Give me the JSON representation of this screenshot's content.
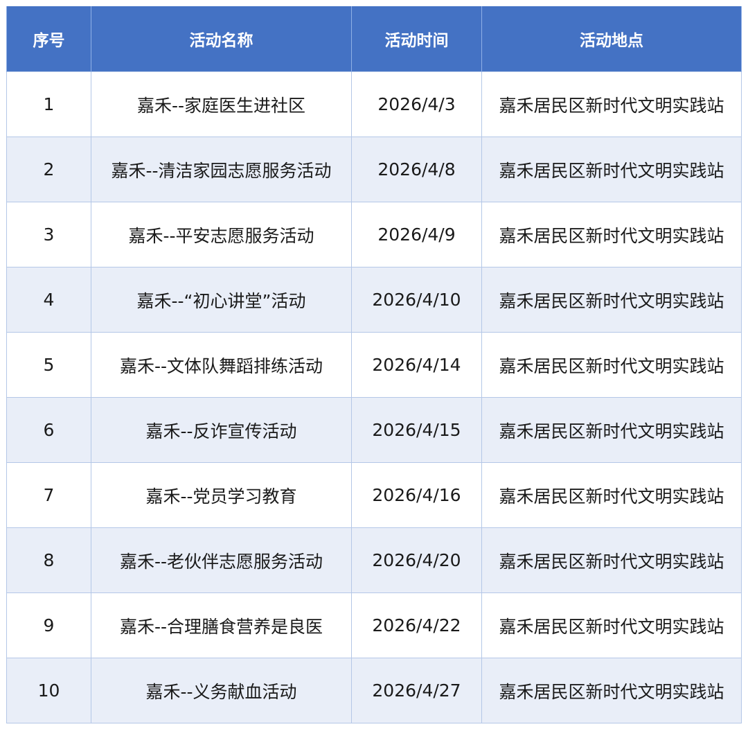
{
  "table": {
    "headers": [
      "序号",
      "活动名称",
      "活动时间",
      "活动地点"
    ],
    "rows": [
      [
        "1",
        "嘉禾--家庭医生进社区",
        "2026/4/3",
        "嘉禾居民区新时代文明实践站"
      ],
      [
        "2",
        "嘉禾--清洁家园志愿服务活动",
        "2026/4/8",
        "嘉禾居民区新时代文明实践站"
      ],
      [
        "3",
        "嘉禾--平安志愿服务活动",
        "2026/4/9",
        "嘉禾居民区新时代文明实践站"
      ],
      [
        "4",
        "嘉禾--“初心讲堂”活动",
        "2026/4/10",
        "嘉禾居民区新时代文明实践站"
      ],
      [
        "5",
        "嘉禾--文体队舞蹈排练活动",
        "2026/4/14",
        "嘉禾居民区新时代文明实践站"
      ],
      [
        "6",
        "嘉禾--反诈宣传活动",
        "2026/4/15",
        "嘉禾居民区新时代文明实践站"
      ],
      [
        "7",
        "嘉禾--党员学习教育",
        "2026/4/16",
        "嘉禾居民区新时代文明实践站"
      ],
      [
        "8",
        "嘉禾--老伙伴志愿服务活动",
        "2026/4/20",
        "嘉禾居民区新时代文明实践站"
      ],
      [
        "9",
        "嘉禾--合理膳食营养是良医",
        "2026/4/22",
        "嘉禾居民区新时代文明实践站"
      ],
      [
        "10",
        "嘉禾--义务献血活动",
        "2026/4/27",
        "嘉禾居民区新时代文明实践站"
      ]
    ]
  },
  "colors": {
    "header_bg": "#4472c4",
    "header_text": "#ffffff",
    "row_alt_bg": "#e9eef8",
    "border": "#b4c7e7"
  }
}
